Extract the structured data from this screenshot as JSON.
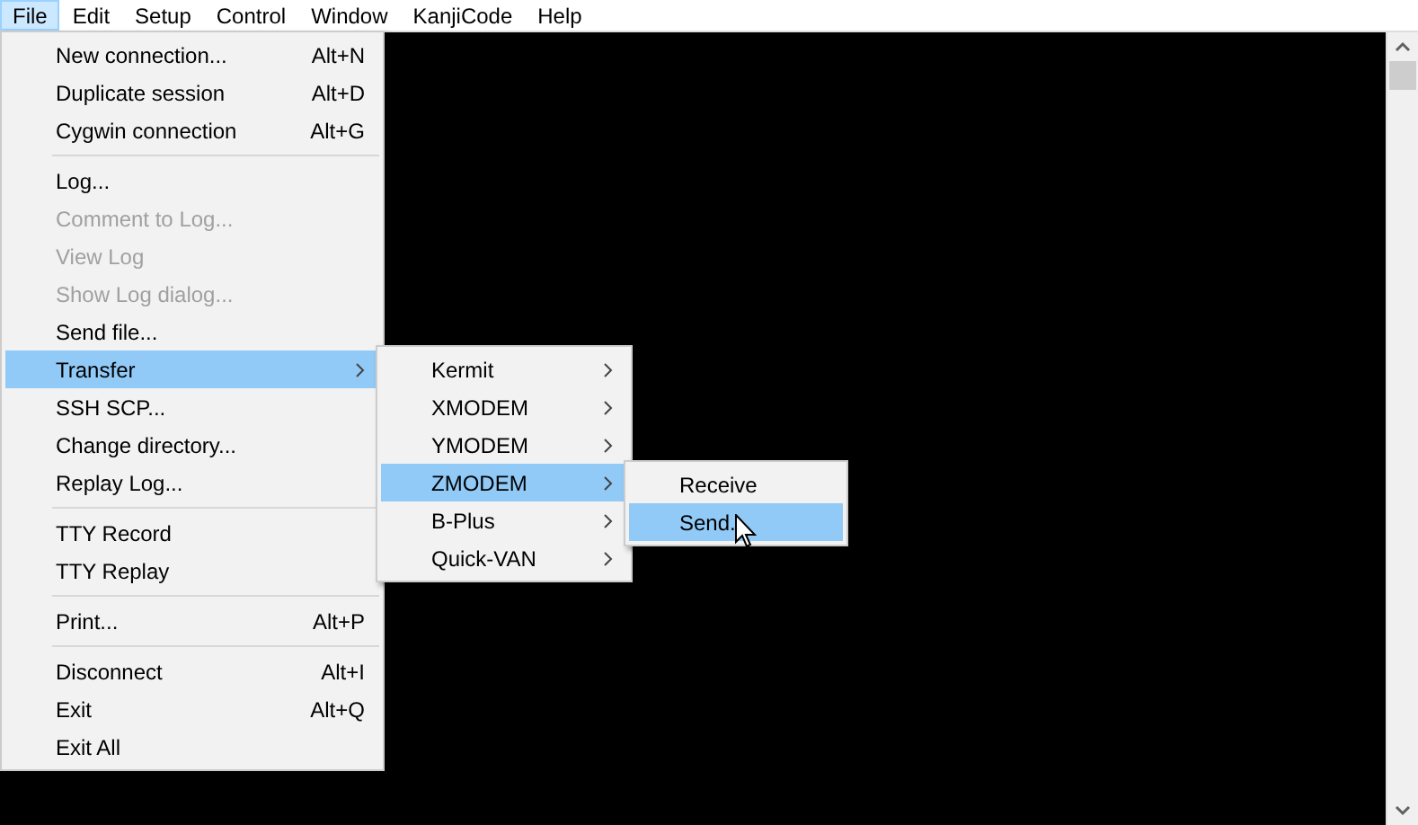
{
  "menubar": {
    "items": [
      {
        "label": "File",
        "selected": true
      },
      {
        "label": "Edit",
        "selected": false
      },
      {
        "label": "Setup",
        "selected": false
      },
      {
        "label": "Control",
        "selected": false
      },
      {
        "label": "Window",
        "selected": false
      },
      {
        "label": "KanjiCode",
        "selected": false
      },
      {
        "label": "Help",
        "selected": false
      }
    ]
  },
  "file_menu": {
    "items": [
      {
        "kind": "item",
        "label": "New connection...",
        "shortcut": "Alt+N",
        "disabled": false,
        "selected": false,
        "submenu": false
      },
      {
        "kind": "item",
        "label": "Duplicate session",
        "shortcut": "Alt+D",
        "disabled": false,
        "selected": false,
        "submenu": false
      },
      {
        "kind": "item",
        "label": "Cygwin connection",
        "shortcut": "Alt+G",
        "disabled": false,
        "selected": false,
        "submenu": false
      },
      {
        "kind": "separator"
      },
      {
        "kind": "item",
        "label": "Log...",
        "disabled": false,
        "selected": false,
        "submenu": false
      },
      {
        "kind": "item",
        "label": "Comment to Log...",
        "disabled": true,
        "selected": false,
        "submenu": false
      },
      {
        "kind": "item",
        "label": "View Log",
        "disabled": true,
        "selected": false,
        "submenu": false
      },
      {
        "kind": "item",
        "label": "Show Log dialog...",
        "disabled": true,
        "selected": false,
        "submenu": false
      },
      {
        "kind": "item",
        "label": "Send file...",
        "disabled": false,
        "selected": false,
        "submenu": false
      },
      {
        "kind": "item",
        "label": "Transfer",
        "disabled": false,
        "selected": true,
        "submenu": true
      },
      {
        "kind": "item",
        "label": "SSH SCP...",
        "disabled": false,
        "selected": false,
        "submenu": false
      },
      {
        "kind": "item",
        "label": "Change directory...",
        "disabled": false,
        "selected": false,
        "submenu": false
      },
      {
        "kind": "item",
        "label": "Replay Log...",
        "disabled": false,
        "selected": false,
        "submenu": false
      },
      {
        "kind": "separator"
      },
      {
        "kind": "item",
        "label": "TTY Record",
        "disabled": false,
        "selected": false,
        "submenu": false
      },
      {
        "kind": "item",
        "label": "TTY Replay",
        "disabled": false,
        "selected": false,
        "submenu": false
      },
      {
        "kind": "separator"
      },
      {
        "kind": "item",
        "label": "Print...",
        "shortcut": "Alt+P",
        "disabled": false,
        "selected": false,
        "submenu": false
      },
      {
        "kind": "separator"
      },
      {
        "kind": "item",
        "label": "Disconnect",
        "shortcut": "Alt+I",
        "disabled": false,
        "selected": false,
        "submenu": false
      },
      {
        "kind": "item",
        "label": "Exit",
        "shortcut": "Alt+Q",
        "disabled": false,
        "selected": false,
        "submenu": false
      },
      {
        "kind": "item",
        "label": "Exit All",
        "disabled": false,
        "selected": false,
        "submenu": false
      }
    ]
  },
  "transfer_submenu": {
    "items": [
      {
        "kind": "item",
        "label": "Kermit",
        "disabled": false,
        "selected": false,
        "submenu": true
      },
      {
        "kind": "item",
        "label": "XMODEM",
        "disabled": false,
        "selected": false,
        "submenu": true
      },
      {
        "kind": "item",
        "label": "YMODEM",
        "disabled": false,
        "selected": false,
        "submenu": true
      },
      {
        "kind": "item",
        "label": "ZMODEM",
        "disabled": false,
        "selected": true,
        "submenu": true
      },
      {
        "kind": "item",
        "label": "B-Plus",
        "disabled": false,
        "selected": false,
        "submenu": true
      },
      {
        "kind": "item",
        "label": "Quick-VAN",
        "disabled": false,
        "selected": false,
        "submenu": true
      }
    ]
  },
  "zmodem_submenu": {
    "items": [
      {
        "kind": "item",
        "label": "Receive",
        "disabled": false,
        "selected": false,
        "submenu": false
      },
      {
        "kind": "item",
        "label": "Send.",
        "disabled": false,
        "selected": true,
        "submenu": false
      }
    ]
  }
}
